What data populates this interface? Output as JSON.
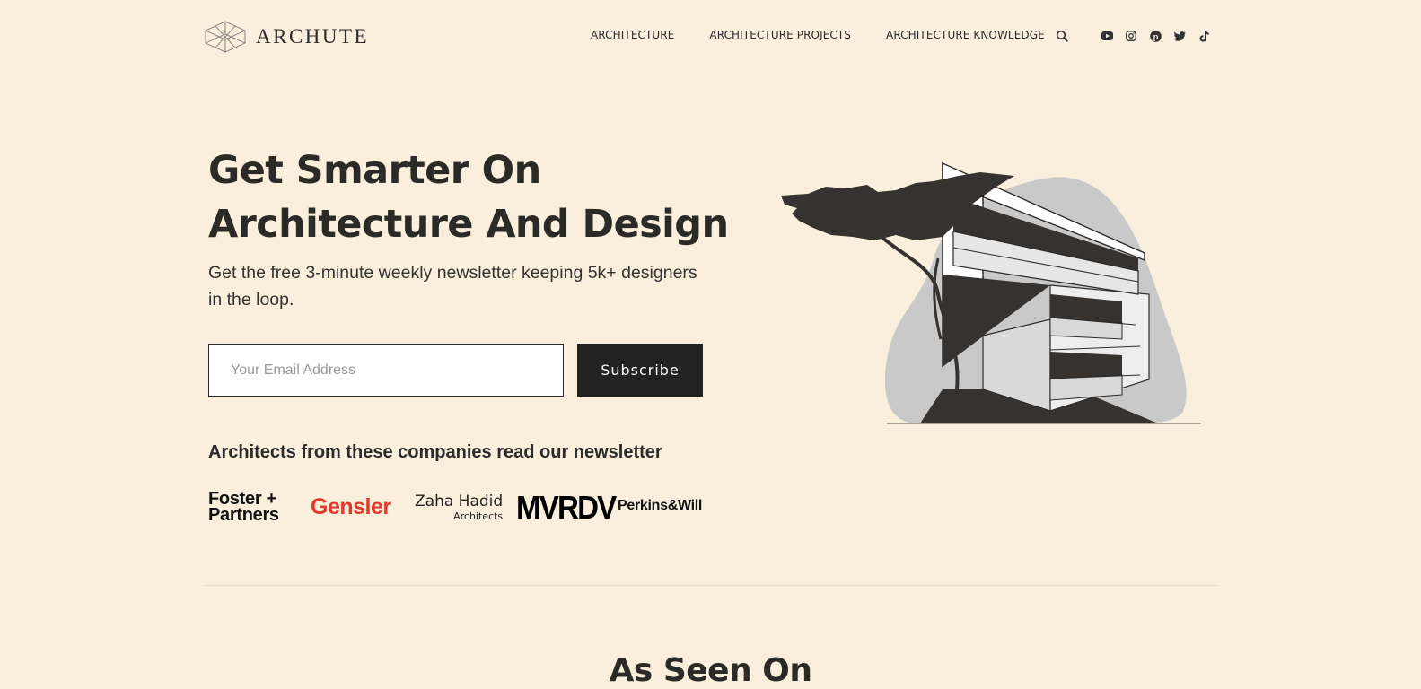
{
  "header": {
    "logo_text": "ARCHUTE",
    "nav": [
      {
        "label": "ARCHITECTURE"
      },
      {
        "label": "ARCHITECTURE PROJECTS"
      },
      {
        "label": "ARCHITECTURE KNOWLEDGE"
      }
    ],
    "social_icons": [
      "youtube-icon",
      "instagram-icon",
      "pinterest-icon",
      "twitter-icon",
      "tiktok-icon"
    ]
  },
  "hero": {
    "title_line1": "Get Smarter On",
    "title_line2": "Architecture And Design",
    "subtitle": "Get the free 3-minute weekly newsletter keeping 5k+ designers in the loop.",
    "email_placeholder": "Your Email Address",
    "subscribe_label": "Subscribe",
    "companies_heading": "Architects from these companies read our newsletter"
  },
  "companies": {
    "foster_line1": "Foster +",
    "foster_line2": "Partners",
    "gensler": "Gensler",
    "zaha_line1": "Zaha Hadid",
    "zaha_line2": "Architects",
    "mvrdv": "MVRDV",
    "perkins": "Perkins&Will"
  },
  "section": {
    "as_seen_on": "As Seen On"
  },
  "colors": {
    "background": "#faeedc",
    "text": "#2b2b2b",
    "button": "#222222",
    "gensler_red": "#e03a2f"
  }
}
